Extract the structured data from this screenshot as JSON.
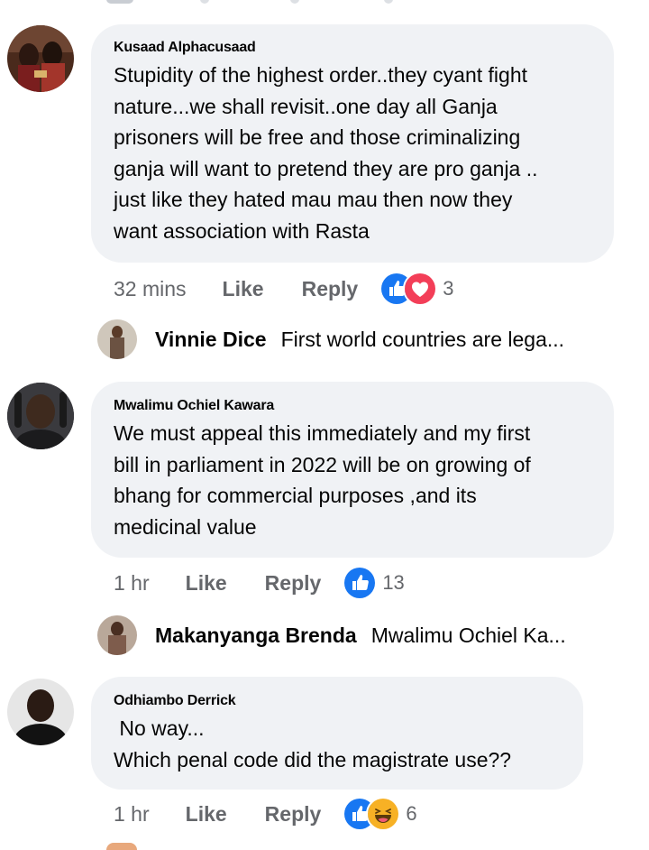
{
  "comments": [
    {
      "author": "Kusaad Alphacusaad",
      "text": "Stupidity of the highest order..they cyant fight\nnature...we shall revisit..one day all Ganja\nprisoners will be free and those criminalizing\nganja will want to pretend they are pro ganja ..\njust like they hated mau mau then now they\nwant association with Rasta",
      "time": "32 mins",
      "like_label": "Like",
      "reply_label": "Reply",
      "reactions": [
        "like-reaction-icon",
        "love-reaction-icon"
      ],
      "reaction_count": "3",
      "reply_preview": {
        "name": "Vinnie Dice",
        "text": "First world countries are lega..."
      }
    },
    {
      "author": "Mwalimu Ochiel Kawara",
      "text": "We must appeal this immediately and my first\nbill in parliament in 2022 will be on growing of\nbhang for commercial purposes ,and its\nmedicinal value",
      "time": "1 hr",
      "like_label": "Like",
      "reply_label": "Reply",
      "reactions": [
        "like-reaction-icon"
      ],
      "reaction_count": "13",
      "reply_preview": {
        "name": "Makanyanga Brenda",
        "text": "Mwalimu Ochiel Ka..."
      }
    },
    {
      "author": "Odhiambo Derrick",
      "text": " No way...\nWhich penal code did the magistrate use??",
      "time": "1 hr",
      "like_label": "Like",
      "reply_label": "Reply",
      "reactions": [
        "like-reaction-icon",
        "haha-reaction-icon"
      ],
      "reaction_count": "6"
    }
  ],
  "colors": {
    "bubble": "#f0f2f5",
    "meta_text": "#65676b",
    "like_blue": "#1877f2",
    "love_red": "#f33e58",
    "haha_yellow": "#f7b125"
  }
}
